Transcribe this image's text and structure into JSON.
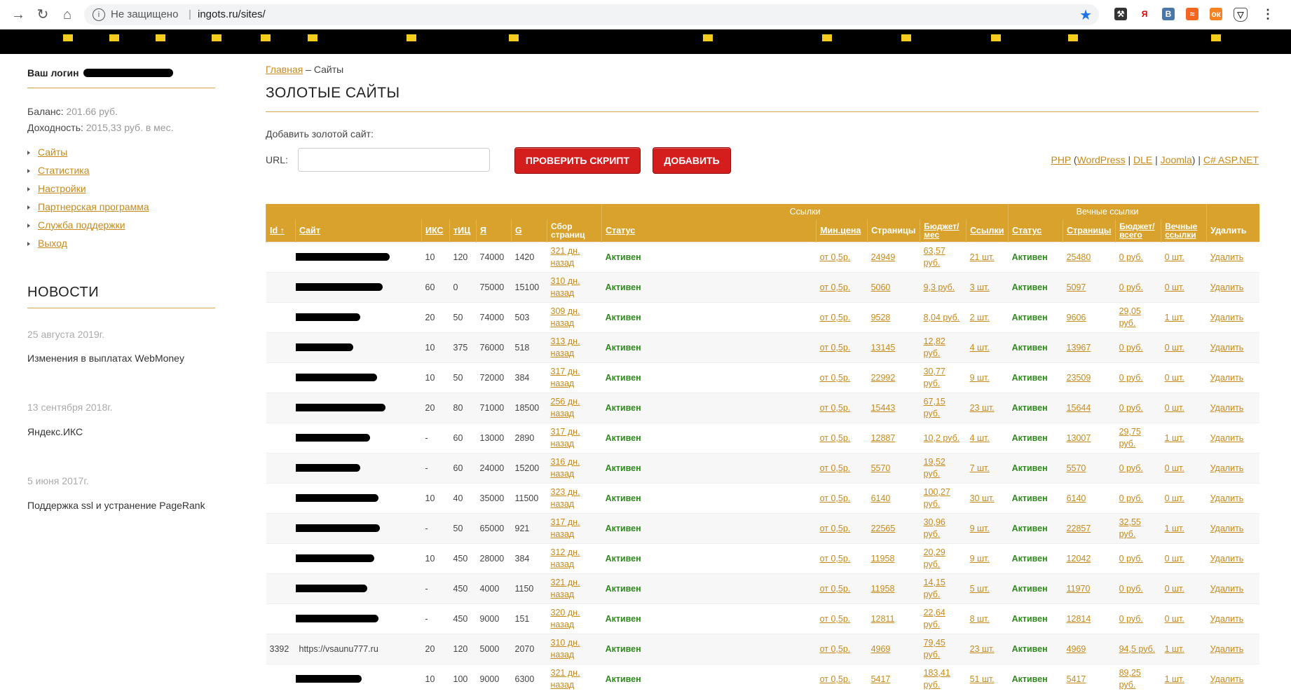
{
  "browser": {
    "security_label": "Не защищено",
    "url": "ingots.ru/sites/"
  },
  "sidebar": {
    "login_label": "Ваш логин",
    "balance_label": "Баланс:",
    "balance_value": "201.66 руб.",
    "income_label": "Доходность:",
    "income_value": "2015,33 руб. в мес.",
    "menu": [
      "Сайты",
      "Статистика",
      "Настройки",
      "Партнерская программа",
      "Служба поддержки",
      "Выход"
    ],
    "news_title": "НОВОСТИ",
    "news": [
      {
        "date": "25 августа 2019г.",
        "text": "Изменения в выплатах WebMoney"
      },
      {
        "date": "13 сентября 2018г.",
        "text": "Яндекс.ИКС"
      },
      {
        "date": "5 июня 2017г.",
        "text": "Поддержка ssl и устранение PageRank"
      }
    ]
  },
  "main": {
    "breadcrumb_home": "Главная",
    "breadcrumb_sep": " – ",
    "breadcrumb_current": "Сайты",
    "title": "ЗОЛОТЫЕ САЙТЫ",
    "add_label": "Добавить золотой сайт:",
    "url_label": "URL:",
    "check_button": "ПРОВЕРИТЬ СКРИПТ",
    "add_button": "ДОБАВИТЬ",
    "cms": {
      "php": "PHP",
      "open": " (",
      "wordpress": "WordPress",
      "sep1": " | ",
      "dle": "DLE",
      "sep2": " | ",
      "joomla": "Joomla",
      "close": ") | ",
      "asp": "C# ASP.NET"
    }
  },
  "table": {
    "group_links": "Ссылки",
    "group_eternal": "Вечные ссылки",
    "headers": {
      "id": "Id ↑",
      "site": "Сайт",
      "iks": "ИКС",
      "tic": "тИЦ",
      "ya": "Я",
      "g": "G",
      "collect": "Сбор страниц",
      "status": "Статус",
      "minprice": "Мин.цена",
      "pages": "Страницы",
      "budget": "Бюджет/ мес",
      "links": "Ссылки",
      "status2": "Статус",
      "pages2": "Страницы",
      "budget2": "Бюджет/ всего",
      "eternal": "Вечные ссылки",
      "delete": "Удалить"
    },
    "rows": [
      {
        "id": "",
        "site": "",
        "iks": "10",
        "tic": "120",
        "ya": "74000",
        "g": "1420",
        "collect": "321 дн. назад",
        "status": "Активен",
        "min": "от 0,5р.",
        "pages": "24949",
        "budget": "63,57 руб.",
        "links": "21 шт.",
        "status2": "Активен",
        "pages2": "25480",
        "budget2": "0 руб.",
        "eternal": "0 шт.",
        "del": "Удалить"
      },
      {
        "id": "",
        "site": "",
        "iks": "60",
        "tic": "0",
        "ya": "75000",
        "g": "15100",
        "collect": "310 дн. назад",
        "status": "Активен",
        "min": "от 0,5р.",
        "pages": "5060",
        "budget": "9,3 руб.",
        "links": "3 шт.",
        "status2": "Активен",
        "pages2": "5097",
        "budget2": "0 руб.",
        "eternal": "0 шт.",
        "del": "Удалить"
      },
      {
        "id": "",
        "site": "",
        "iks": "20",
        "tic": "50",
        "ya": "74000",
        "g": "503",
        "collect": "309 дн. назад",
        "status": "Активен",
        "min": "от 0,5р.",
        "pages": "9528",
        "budget": "8,04 руб.",
        "links": "2 шт.",
        "status2": "Активен",
        "pages2": "9606",
        "budget2": "29,05 руб.",
        "eternal": "1 шт.",
        "del": "Удалить"
      },
      {
        "id": "",
        "site": "",
        "iks": "10",
        "tic": "375",
        "ya": "76000",
        "g": "518",
        "collect": "313 дн. назад",
        "status": "Активен",
        "min": "от 0,5р.",
        "pages": "13145",
        "budget": "12,82 руб.",
        "links": "4 шт.",
        "status2": "Активен",
        "pages2": "13967",
        "budget2": "0 руб.",
        "eternal": "0 шт.",
        "del": "Удалить"
      },
      {
        "id": "",
        "site": "",
        "iks": "10",
        "tic": "50",
        "ya": "72000",
        "g": "384",
        "collect": "317 дн. назад",
        "status": "Активен",
        "min": "от 0,5р.",
        "pages": "22992",
        "budget": "30,77 руб.",
        "links": "9 шт.",
        "status2": "Активен",
        "pages2": "23509",
        "budget2": "0 руб.",
        "eternal": "0 шт.",
        "del": "Удалить"
      },
      {
        "id": "",
        "site": "",
        "iks": "20",
        "tic": "80",
        "ya": "71000",
        "g": "18500",
        "collect": "256 дн. назад",
        "status": "Активен",
        "min": "от 0,5р.",
        "pages": "15443",
        "budget": "67,15 руб.",
        "links": "23 шт.",
        "status2": "Активен",
        "pages2": "15644",
        "budget2": "0 руб.",
        "eternal": "0 шт.",
        "del": "Удалить"
      },
      {
        "id": "",
        "site": "",
        "iks": "-",
        "tic": "60",
        "ya": "13000",
        "g": "2890",
        "collect": "317 дн. назад",
        "status": "Активен",
        "min": "от 0,5р.",
        "pages": "12887",
        "budget": "10,2 руб.",
        "links": "4 шт.",
        "status2": "Активен",
        "pages2": "13007",
        "budget2": "29,75 руб.",
        "eternal": "1 шт.",
        "del": "Удалить"
      },
      {
        "id": "",
        "site": "",
        "iks": "-",
        "tic": "60",
        "ya": "24000",
        "g": "15200",
        "collect": "316 дн. назад",
        "status": "Активен",
        "min": "от 0,5р.",
        "pages": "5570",
        "budget": "19,52 руб.",
        "links": "7 шт.",
        "status2": "Активен",
        "pages2": "5570",
        "budget2": "0 руб.",
        "eternal": "0 шт.",
        "del": "Удалить"
      },
      {
        "id": "",
        "site": "",
        "iks": "10",
        "tic": "40",
        "ya": "35000",
        "g": "11500",
        "collect": "323 дн. назад",
        "status": "Активен",
        "min": "от 0,5р.",
        "pages": "6140",
        "budget": "100,27 руб.",
        "links": "30 шт.",
        "status2": "Активен",
        "pages2": "6140",
        "budget2": "0 руб.",
        "eternal": "0 шт.",
        "del": "Удалить"
      },
      {
        "id": "",
        "site": "",
        "iks": "-",
        "tic": "50",
        "ya": "65000",
        "g": "921",
        "collect": "317 дн. назад",
        "status": "Активен",
        "min": "от 0,5р.",
        "pages": "22565",
        "budget": "30,96 руб.",
        "links": "9 шт.",
        "status2": "Активен",
        "pages2": "22857",
        "budget2": "32,55 руб.",
        "eternal": "1 шт.",
        "del": "Удалить"
      },
      {
        "id": "",
        "site": "",
        "iks": "10",
        "tic": "450",
        "ya": "28000",
        "g": "384",
        "collect": "312 дн. назад",
        "status": "Активен",
        "min": "от 0,5р.",
        "pages": "11958",
        "budget": "20,29 руб.",
        "links": "9 шт.",
        "status2": "Активен",
        "pages2": "12042",
        "budget2": "0 руб.",
        "eternal": "0 шт.",
        "del": "Удалить"
      },
      {
        "id": "",
        "site": "",
        "iks": "-",
        "tic": "450",
        "ya": "4000",
        "g": "1150",
        "collect": "321 дн. назад",
        "status": "Активен",
        "min": "от 0,5р.",
        "pages": "11958",
        "budget": "14,15 руб.",
        "links": "5 шт.",
        "status2": "Активен",
        "pages2": "11970",
        "budget2": "0 руб.",
        "eternal": "0 шт.",
        "del": "Удалить"
      },
      {
        "id": "",
        "site": "",
        "iks": "-",
        "tic": "450",
        "ya": "9000",
        "g": "151",
        "collect": "320 дн. назад",
        "status": "Активен",
        "min": "от 0,5р.",
        "pages": "12811",
        "budget": "22,64 руб.",
        "links": "8 шт.",
        "status2": "Активен",
        "pages2": "12814",
        "budget2": "0 руб.",
        "eternal": "0 шт.",
        "del": "Удалить"
      },
      {
        "id": "3392",
        "site": "https://vsaunu777.ru",
        "iks": "20",
        "tic": "120",
        "ya": "5000",
        "g": "2070",
        "collect": "310 дн. назад",
        "status": "Активен",
        "min": "от 0,5р.",
        "pages": "4969",
        "budget": "79,45 руб.",
        "links": "23 шт.",
        "status2": "Активен",
        "pages2": "4969",
        "budget2": "94,5 руб.",
        "eternal": "1 шт.",
        "del": "Удалить"
      },
      {
        "id": "",
        "site": "",
        "iks": "10",
        "tic": "100",
        "ya": "9000",
        "g": "6300",
        "collect": "321 дн. назад",
        "status": "Активен",
        "min": "от 0,5р.",
        "pages": "5417",
        "budget": "183,41 руб.",
        "links": "51 шт.",
        "status2": "Активен",
        "pages2": "5417",
        "budget2": "89,25 руб.",
        "eternal": "1 шт.",
        "del": "Удалить"
      }
    ]
  },
  "colors": {
    "accent": "#d9a22c",
    "link": "#c68a1c",
    "active": "#2f8a1e",
    "button": "#d41e1e"
  }
}
